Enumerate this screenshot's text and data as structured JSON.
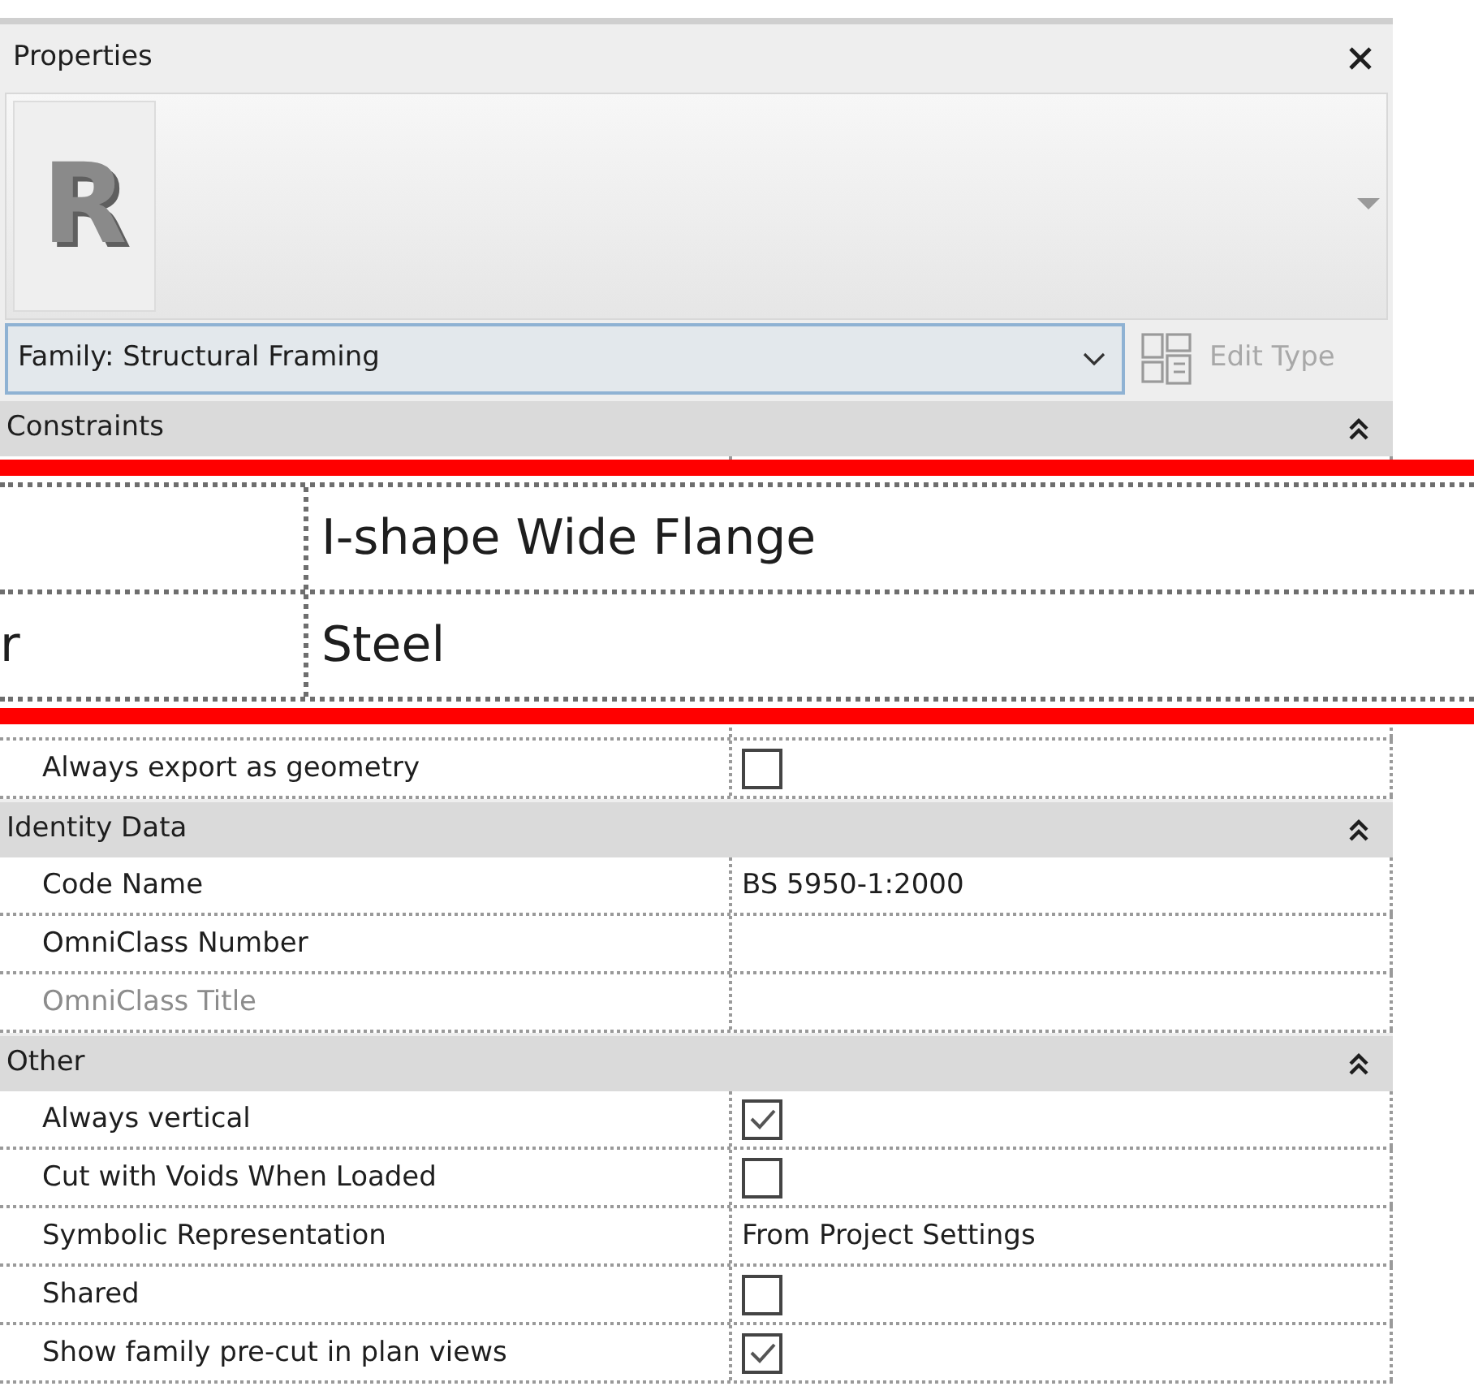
{
  "panel": {
    "title": "Properties"
  },
  "type_image": {
    "logo_text": "R"
  },
  "type_selector": {
    "value": "Family: Structural Framing"
  },
  "edit_type": {
    "label": "Edit Type",
    "disabled": true
  },
  "rows": [
    {
      "kind": "header",
      "title": "Constraints",
      "expanded": true
    },
    {
      "kind": "checkbox",
      "label": "Always export as geometry",
      "checked": false,
      "disabled": false
    },
    {
      "kind": "header",
      "title": "Identity Data",
      "expanded": true
    },
    {
      "kind": "text",
      "label": "Code Name",
      "value": "BS 5950-1:2000",
      "disabled": false
    },
    {
      "kind": "text",
      "label": "OmniClass Number",
      "disabled": false
    },
    {
      "kind": "text",
      "label": "OmniClass Title",
      "disabled": true
    },
    {
      "kind": "header",
      "title": "Other",
      "expanded": true
    },
    {
      "kind": "checkbox",
      "label": "Always vertical",
      "checked": true,
      "disabled": false
    },
    {
      "kind": "checkbox",
      "label": "Cut with Voids When Loaded",
      "checked": false,
      "disabled": false
    },
    {
      "kind": "text",
      "label": "Symbolic Representation",
      "value": "From Project Settings",
      "disabled": false
    },
    {
      "kind": "checkbox",
      "label": "Shared",
      "checked": false,
      "disabled": false
    },
    {
      "kind": "checkbox",
      "label": "Show family pre-cut in plan views",
      "checked": true,
      "disabled": false
    }
  ],
  "magnifier": {
    "rows": [
      {
        "value": "I-shape Wide Flange"
      },
      {
        "label": "r",
        "value": "Steel"
      }
    ]
  }
}
